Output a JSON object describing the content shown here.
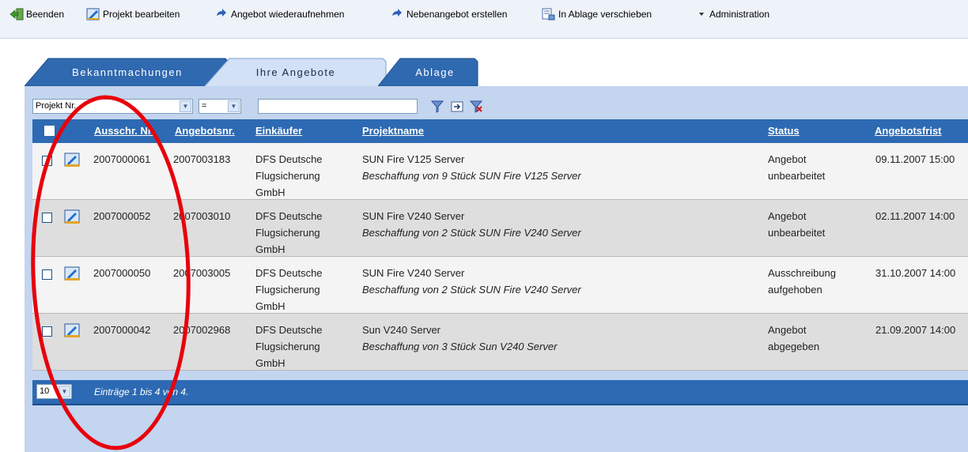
{
  "toolbar": {
    "items": [
      {
        "label": "Beenden",
        "icon": "exit-icon"
      },
      {
        "label": "Projekt bearbeiten",
        "icon": "edit-project-icon"
      },
      {
        "label": "Angebot wiederaufnehmen",
        "icon": "resume-arrow-icon"
      },
      {
        "label": "Nebenangebot erstellen",
        "icon": "resume-arrow-icon"
      },
      {
        "label": "In Ablage verschieben",
        "icon": "archive-move-icon"
      },
      {
        "label": "Administration",
        "icon": "dropdown-triangle-icon"
      }
    ]
  },
  "tabs": [
    {
      "label": "Bekanntmachungen",
      "active": false
    },
    {
      "label": "Ihre Angebote",
      "active": true
    },
    {
      "label": "Ablage",
      "active": false
    }
  ],
  "filter": {
    "field": "Projekt Nr.",
    "operator": "=",
    "value": ""
  },
  "table": {
    "headers": [
      "Ausschr. Nr.",
      "Angebotsnr.",
      "Einkäufer",
      "Projektname",
      "Status",
      "Angebotsfrist"
    ],
    "rows": [
      {
        "ausschr": "2007000061",
        "angebot": "2007003183",
        "einkaeufer": [
          "DFS Deutsche",
          "Flugsicherung",
          "GmbH"
        ],
        "projekt": "SUN Fire V125 Server",
        "beschreibung": "Beschaffung von 9 Stück SUN Fire V125 Server",
        "status": [
          "Angebot",
          "unbearbeitet"
        ],
        "frist": "09.11.2007 15:00"
      },
      {
        "ausschr": "2007000052",
        "angebot": "2007003010",
        "einkaeufer": [
          "DFS Deutsche",
          "Flugsicherung",
          "GmbH"
        ],
        "projekt": "SUN Fire V240 Server",
        "beschreibung": "Beschaffung von 2 Stück SUN Fire V240 Server",
        "status": [
          "Angebot",
          "unbearbeitet"
        ],
        "frist": "02.11.2007 14:00"
      },
      {
        "ausschr": "2007000050",
        "angebot": "2007003005",
        "einkaeufer": [
          "DFS Deutsche",
          "Flugsicherung",
          "GmbH"
        ],
        "projekt": "SUN Fire V240 Server",
        "beschreibung": "Beschaffung von 2 Stück SUN Fire V240 Server",
        "status": [
          "Ausschreibung",
          "aufgehoben"
        ],
        "frist": "31.10.2007 14:00"
      },
      {
        "ausschr": "2007000042",
        "angebot": "2007002968",
        "einkaeufer": [
          "DFS Deutsche",
          "Flugsicherung",
          "GmbH"
        ],
        "projekt": "Sun V240 Server",
        "beschreibung": "Beschaffung von 3 Stück Sun V240 Server",
        "status": [
          "Angebot",
          "abgegeben"
        ],
        "frist": "21.09.2007 14:00"
      }
    ]
  },
  "footer": {
    "page_size": "10",
    "info": "Einträge 1 bis 4 von 4."
  },
  "colors": {
    "header_blue": "#2d6ab3",
    "panel_blue": "#c3d5ef",
    "annotation_red": "#e8000b"
  }
}
